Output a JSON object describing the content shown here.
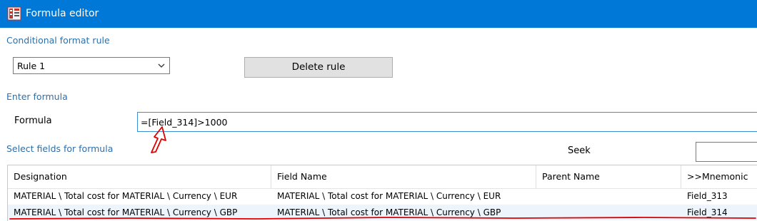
{
  "window": {
    "title": "Formula editor",
    "titlebar_color": "#0078d7",
    "app_icon": "formula-app-icon"
  },
  "conditional_format": {
    "section_label": "Conditional format rule",
    "rule_select_value": "Rule 1",
    "delete_button_label": "Delete rule"
  },
  "formula_section": {
    "section_label": "Enter formula",
    "formula_label": "Formula",
    "formula_value": "=[Field_314]>1000"
  },
  "fields_section": {
    "section_label": "Select fields for formula",
    "seek_label": "Seek",
    "seek_value": ""
  },
  "grid": {
    "columns": [
      "Designation",
      "Field Name",
      "Parent Name",
      ">>Mnemonic"
    ],
    "rows": [
      {
        "designation": "MATERIAL \\ Total cost for MATERIAL \\ Currency \\ EUR",
        "field_name": "MATERIAL \\ Total cost for MATERIAL \\ Currency \\ EUR",
        "parent_name": "",
        "mnemonic": "Field_313"
      },
      {
        "designation": "MATERIAL \\ Total cost for MATERIAL \\ Currency \\ GBP",
        "field_name": "MATERIAL \\ Total cost for MATERIAL \\ Currency \\ GBP",
        "parent_name": "",
        "mnemonic": "Field_314"
      }
    ]
  },
  "annotations": {
    "marker_color": "#e00000"
  }
}
